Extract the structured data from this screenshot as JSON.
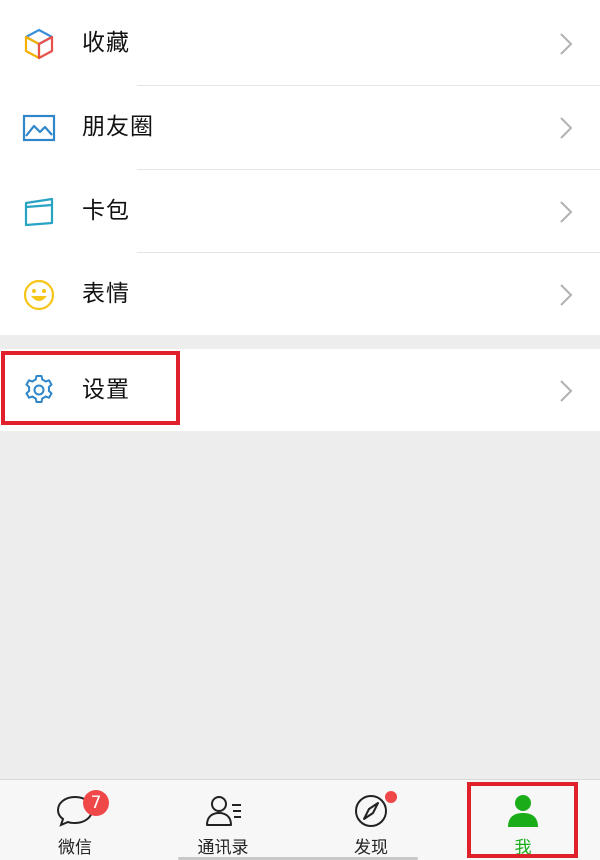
{
  "menu": {
    "favorites": {
      "label": "收藏",
      "icon": "cube-icon"
    },
    "moments": {
      "label": "朋友圈",
      "icon": "picture-icon"
    },
    "cards": {
      "label": "卡包",
      "icon": "card-icon"
    },
    "stickers": {
      "label": "表情",
      "icon": "smiley-icon"
    },
    "settings": {
      "label": "设置",
      "icon": "gear-icon"
    }
  },
  "tabbar": {
    "chats": {
      "label": "微信",
      "badge": "7",
      "icon": "chat-bubble-icon"
    },
    "contacts": {
      "label": "通讯录",
      "icon": "contacts-icon"
    },
    "discover": {
      "label": "发现",
      "icon": "compass-icon"
    },
    "me": {
      "label": "我",
      "icon": "person-icon"
    }
  },
  "colors": {
    "accent_green": "#1aad19",
    "badge_red": "#f04848",
    "highlight_red": "#e0202b",
    "background": "#ededed"
  }
}
